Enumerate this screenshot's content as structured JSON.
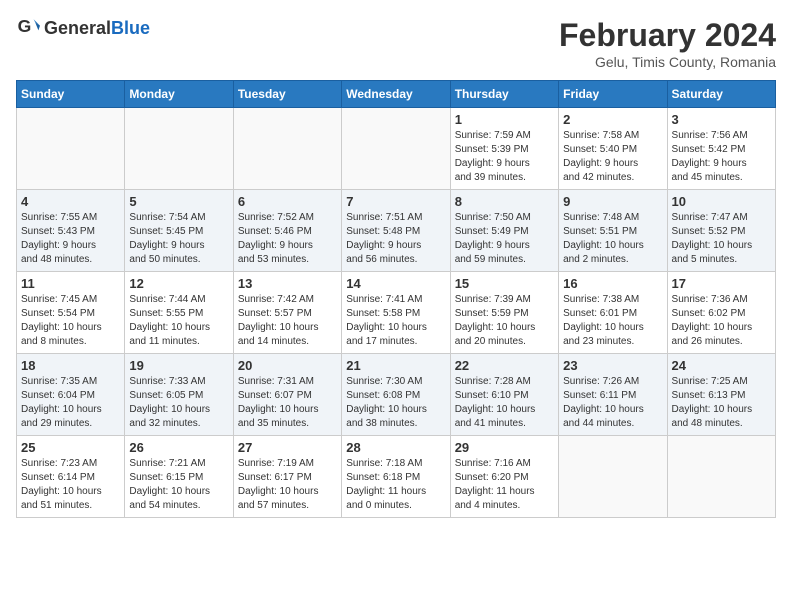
{
  "header": {
    "logo_general": "General",
    "logo_blue": "Blue",
    "title": "February 2024",
    "subtitle": "Gelu, Timis County, Romania"
  },
  "calendar": {
    "days_of_week": [
      "Sunday",
      "Monday",
      "Tuesday",
      "Wednesday",
      "Thursday",
      "Friday",
      "Saturday"
    ],
    "weeks": [
      [
        {
          "day": "",
          "info": ""
        },
        {
          "day": "",
          "info": ""
        },
        {
          "day": "",
          "info": ""
        },
        {
          "day": "",
          "info": ""
        },
        {
          "day": "1",
          "info": "Sunrise: 7:59 AM\nSunset: 5:39 PM\nDaylight: 9 hours\nand 39 minutes."
        },
        {
          "day": "2",
          "info": "Sunrise: 7:58 AM\nSunset: 5:40 PM\nDaylight: 9 hours\nand 42 minutes."
        },
        {
          "day": "3",
          "info": "Sunrise: 7:56 AM\nSunset: 5:42 PM\nDaylight: 9 hours\nand 45 minutes."
        }
      ],
      [
        {
          "day": "4",
          "info": "Sunrise: 7:55 AM\nSunset: 5:43 PM\nDaylight: 9 hours\nand 48 minutes."
        },
        {
          "day": "5",
          "info": "Sunrise: 7:54 AM\nSunset: 5:45 PM\nDaylight: 9 hours\nand 50 minutes."
        },
        {
          "day": "6",
          "info": "Sunrise: 7:52 AM\nSunset: 5:46 PM\nDaylight: 9 hours\nand 53 minutes."
        },
        {
          "day": "7",
          "info": "Sunrise: 7:51 AM\nSunset: 5:48 PM\nDaylight: 9 hours\nand 56 minutes."
        },
        {
          "day": "8",
          "info": "Sunrise: 7:50 AM\nSunset: 5:49 PM\nDaylight: 9 hours\nand 59 minutes."
        },
        {
          "day": "9",
          "info": "Sunrise: 7:48 AM\nSunset: 5:51 PM\nDaylight: 10 hours\nand 2 minutes."
        },
        {
          "day": "10",
          "info": "Sunrise: 7:47 AM\nSunset: 5:52 PM\nDaylight: 10 hours\nand 5 minutes."
        }
      ],
      [
        {
          "day": "11",
          "info": "Sunrise: 7:45 AM\nSunset: 5:54 PM\nDaylight: 10 hours\nand 8 minutes."
        },
        {
          "day": "12",
          "info": "Sunrise: 7:44 AM\nSunset: 5:55 PM\nDaylight: 10 hours\nand 11 minutes."
        },
        {
          "day": "13",
          "info": "Sunrise: 7:42 AM\nSunset: 5:57 PM\nDaylight: 10 hours\nand 14 minutes."
        },
        {
          "day": "14",
          "info": "Sunrise: 7:41 AM\nSunset: 5:58 PM\nDaylight: 10 hours\nand 17 minutes."
        },
        {
          "day": "15",
          "info": "Sunrise: 7:39 AM\nSunset: 5:59 PM\nDaylight: 10 hours\nand 20 minutes."
        },
        {
          "day": "16",
          "info": "Sunrise: 7:38 AM\nSunset: 6:01 PM\nDaylight: 10 hours\nand 23 minutes."
        },
        {
          "day": "17",
          "info": "Sunrise: 7:36 AM\nSunset: 6:02 PM\nDaylight: 10 hours\nand 26 minutes."
        }
      ],
      [
        {
          "day": "18",
          "info": "Sunrise: 7:35 AM\nSunset: 6:04 PM\nDaylight: 10 hours\nand 29 minutes."
        },
        {
          "day": "19",
          "info": "Sunrise: 7:33 AM\nSunset: 6:05 PM\nDaylight: 10 hours\nand 32 minutes."
        },
        {
          "day": "20",
          "info": "Sunrise: 7:31 AM\nSunset: 6:07 PM\nDaylight: 10 hours\nand 35 minutes."
        },
        {
          "day": "21",
          "info": "Sunrise: 7:30 AM\nSunset: 6:08 PM\nDaylight: 10 hours\nand 38 minutes."
        },
        {
          "day": "22",
          "info": "Sunrise: 7:28 AM\nSunset: 6:10 PM\nDaylight: 10 hours\nand 41 minutes."
        },
        {
          "day": "23",
          "info": "Sunrise: 7:26 AM\nSunset: 6:11 PM\nDaylight: 10 hours\nand 44 minutes."
        },
        {
          "day": "24",
          "info": "Sunrise: 7:25 AM\nSunset: 6:13 PM\nDaylight: 10 hours\nand 48 minutes."
        }
      ],
      [
        {
          "day": "25",
          "info": "Sunrise: 7:23 AM\nSunset: 6:14 PM\nDaylight: 10 hours\nand 51 minutes."
        },
        {
          "day": "26",
          "info": "Sunrise: 7:21 AM\nSunset: 6:15 PM\nDaylight: 10 hours\nand 54 minutes."
        },
        {
          "day": "27",
          "info": "Sunrise: 7:19 AM\nSunset: 6:17 PM\nDaylight: 10 hours\nand 57 minutes."
        },
        {
          "day": "28",
          "info": "Sunrise: 7:18 AM\nSunset: 6:18 PM\nDaylight: 11 hours\nand 0 minutes."
        },
        {
          "day": "29",
          "info": "Sunrise: 7:16 AM\nSunset: 6:20 PM\nDaylight: 11 hours\nand 4 minutes."
        },
        {
          "day": "",
          "info": ""
        },
        {
          "day": "",
          "info": ""
        }
      ]
    ]
  }
}
